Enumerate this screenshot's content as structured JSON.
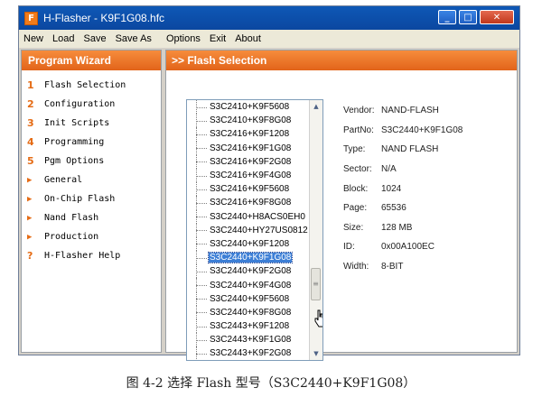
{
  "window": {
    "title": "H-Flasher - K9F1G08.hfc",
    "app_icon": "F",
    "controls": {
      "minimize": "_",
      "maximize": "□",
      "close": "✕"
    }
  },
  "menu": [
    "New",
    "Load",
    "Save",
    "Save As",
    "Options",
    "Exit",
    "About"
  ],
  "wizard": {
    "header": "Program Wizard",
    "items": [
      {
        "marker": "1",
        "label": "Flash Selection"
      },
      {
        "marker": "2",
        "label": "Configuration"
      },
      {
        "marker": "3",
        "label": "Init Scripts"
      },
      {
        "marker": "4",
        "label": "Programming"
      },
      {
        "marker": "5",
        "label": "Pgm Options"
      },
      {
        "marker": "▶",
        "label": "General"
      },
      {
        "marker": "▶",
        "label": "On-Chip Flash"
      },
      {
        "marker": "▶",
        "label": "Nand Flash"
      },
      {
        "marker": "▶",
        "label": "Production"
      },
      {
        "marker": "?",
        "label": "H-Flasher Help"
      }
    ]
  },
  "flash_selection": {
    "header": ">> Flash Selection",
    "list": [
      "S3C2410+K9F5608",
      "S3C2410+K9F8G08",
      "S3C2416+K9F1208",
      "S3C2416+K9F1G08",
      "S3C2416+K9F2G08",
      "S3C2416+K9F4G08",
      "S3C2416+K9F5608",
      "S3C2416+K9F8G08",
      "S3C2440+H8ACS0EH0",
      "S3C2440+HY27US0812",
      "S3C2440+K9F1208",
      "S3C2440+K9F1G08",
      "S3C2440+K9F2G08",
      "S3C2440+K9F4G08",
      "S3C2440+K9F5608",
      "S3C2440+K9F8G08",
      "S3C2443+K9F1208",
      "S3C2443+K9F1G08",
      "S3C2443+K9F2G08"
    ],
    "selected_index": 11,
    "details": [
      {
        "label": "Vendor:",
        "value": "NAND-FLASH"
      },
      {
        "label": "PartNo:",
        "value": "S3C2440+K9F1G08"
      },
      {
        "label": "Type:",
        "value": "NAND FLASH"
      },
      {
        "label": "Sector:",
        "value": "N/A"
      },
      {
        "label": "Block:",
        "value": "1024"
      },
      {
        "label": "Page:",
        "value": "65536"
      },
      {
        "label": "Size:",
        "value": "128 MB"
      },
      {
        "label": "ID:",
        "value": "0x00A100EC"
      },
      {
        "label": "Width:",
        "value": "8-BIT"
      }
    ]
  },
  "caption": "图 4-2 选择 Flash 型号（S3C2440+K9F1G08）",
  "colors": {
    "accent": "#e56b14",
    "header": "#f07a2a",
    "selection": "#3d7fd6",
    "titlebar": "#0b4fae"
  }
}
